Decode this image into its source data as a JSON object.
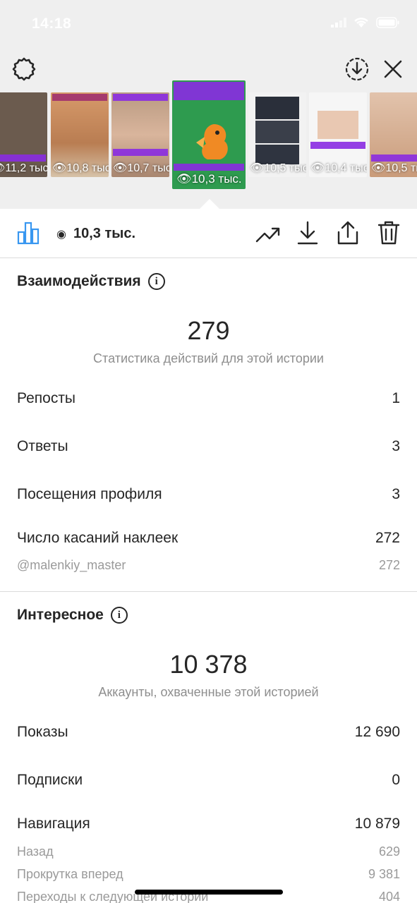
{
  "status_bar": {
    "time": "14:18"
  },
  "stories": [
    {
      "views": "11,2 тыс",
      "bg": "#6b5b4e"
    },
    {
      "views": "10,8 тыс",
      "bg": "#c98a5e"
    },
    {
      "views": "10,7 тыс",
      "bg": "#c9a58a"
    },
    {
      "views": "10,3 тыс.",
      "bg": "#2e9b4f",
      "active": true
    },
    {
      "views": "10,5 тыс",
      "bg": "#f2f2f2"
    },
    {
      "views": "10,4 тыс",
      "bg": "#f6f6f6"
    },
    {
      "views": "10,5 тыс",
      "bg": "#d9b59c"
    }
  ],
  "action_bar": {
    "views": "10,3 тыс."
  },
  "interactions": {
    "title": "Взаимодействия",
    "total": "279",
    "subtitle": "Статистика действий для этой истории",
    "rows": [
      {
        "label": "Репосты",
        "value": "1"
      },
      {
        "label": "Ответы",
        "value": "3"
      },
      {
        "label": "Посещения профиля",
        "value": "3"
      },
      {
        "label": "Число касаний наклеек",
        "value": "272"
      }
    ],
    "sticker_sub": {
      "label": "@malenkiy_master",
      "value": "272"
    }
  },
  "discovery": {
    "title": "Интересное",
    "total": "10 378",
    "subtitle": "Аккаунты, охваченные этой историей",
    "rows": [
      {
        "label": "Показы",
        "value": "12 690"
      },
      {
        "label": "Подписки",
        "value": "0"
      },
      {
        "label": "Навигация",
        "value": "10 879"
      }
    ],
    "nav_sub": [
      {
        "label": "Назад",
        "value": "629"
      },
      {
        "label": "Прокрутка вперед",
        "value": "9 381"
      },
      {
        "label": "Переходы к следующей истории",
        "value": "404"
      }
    ]
  }
}
